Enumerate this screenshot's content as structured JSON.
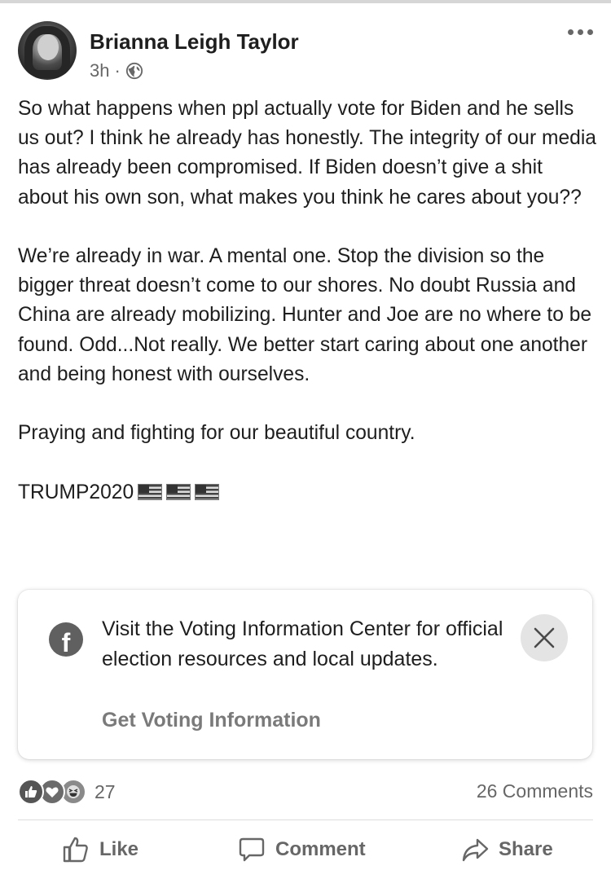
{
  "post": {
    "author": "Brianna Leigh Taylor",
    "time": "3h",
    "separator": "·",
    "audience_icon": "globe-icon",
    "paragraphs": [
      "So what happens when ppl actually vote for Biden and he sells us out? I think he already has honestly. The integrity of our media has already been compromised. If Biden doesn’t give a shit about his own son, what makes you think he cares about you??",
      "We’re already in war. A mental one. Stop the division so the bigger threat doesn’t come to our shores. No doubt Russia and China are already mobilizing. Hunter and Joe are no where to be found. Odd...Not really. We better start caring about one another and being honest with ourselves.",
      "Praying and fighting for our beautiful country.",
      "TRUMP2020"
    ]
  },
  "info_card": {
    "text": "Visit the Voting Information Center for official election resources and local updates.",
    "link": "Get Voting Information",
    "icon": "facebook-icon",
    "close_icon": "close-icon"
  },
  "engagement": {
    "reaction_icons": [
      "like-reaction-icon",
      "love-reaction-icon",
      "haha-reaction-icon"
    ],
    "reaction_count": "27",
    "comments": "26 Comments"
  },
  "actions": {
    "like": "Like",
    "comment": "Comment",
    "share": "Share"
  }
}
